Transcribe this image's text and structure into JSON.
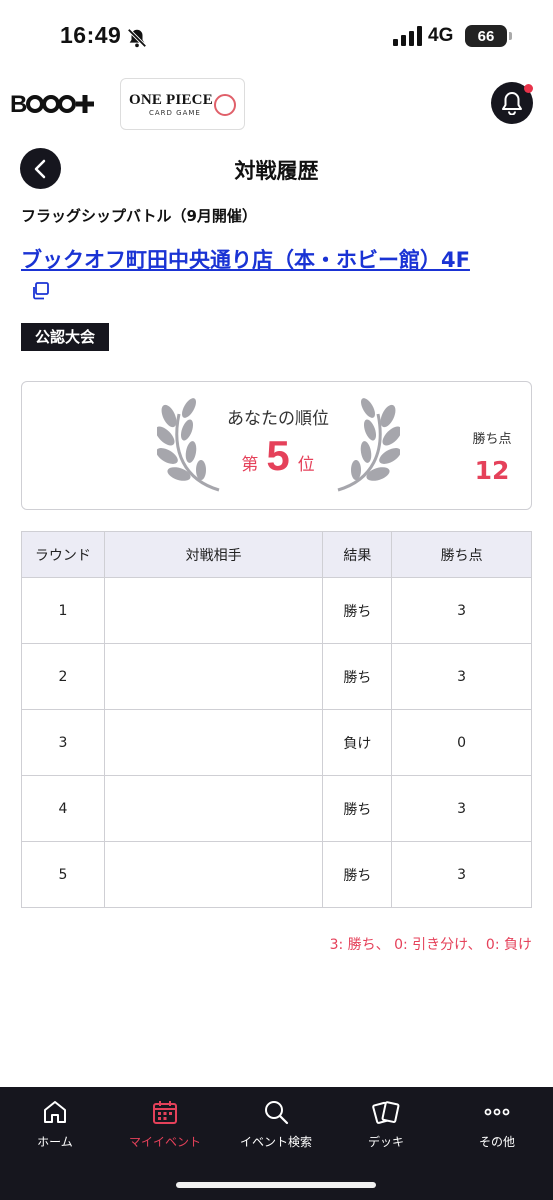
{
  "status_bar": {
    "time": "16:49",
    "network": "4G",
    "battery": "66"
  },
  "header": {
    "app_logo_text": "BOOG+",
    "game_logo_line1": "ONE PIECE",
    "game_logo_line2": "CARD GAME"
  },
  "page": {
    "title": "対戦履歴",
    "event_name": "フラッグシップバトル（9月開催）",
    "store_name": "ブックオフ町田中央通り店（本・ホビー館）4F",
    "badge": "公認大会"
  },
  "ranking": {
    "caption": "あなたの順位",
    "prefix": "第",
    "rank": "5",
    "suffix": "位",
    "points_label": "勝ち点",
    "points": "12"
  },
  "table": {
    "headers": [
      "ラウンド",
      "対戦相手",
      "結果",
      "勝ち点"
    ],
    "rows": [
      {
        "round": "1",
        "opponent": "",
        "result": "勝ち",
        "points": "3"
      },
      {
        "round": "2",
        "opponent": "",
        "result": "勝ち",
        "points": "3"
      },
      {
        "round": "3",
        "opponent": "",
        "result": "負け",
        "points": "0"
      },
      {
        "round": "4",
        "opponent": "",
        "result": "勝ち",
        "points": "3"
      },
      {
        "round": "5",
        "opponent": "",
        "result": "勝ち",
        "points": "3"
      }
    ]
  },
  "legend": "3: 勝ち、 0: 引き分け、 0: 負け",
  "nav": {
    "items": [
      {
        "label": "ホーム",
        "icon": "home-icon"
      },
      {
        "label": "マイイベント",
        "icon": "calendar-icon"
      },
      {
        "label": "イベント検索",
        "icon": "search-icon"
      },
      {
        "label": "デッキ",
        "icon": "cards-icon"
      },
      {
        "label": "その他",
        "icon": "more-icon"
      }
    ],
    "active_index": 1
  },
  "colors": {
    "accent": "#e5415a",
    "link": "#1a33d4",
    "dark": "#16161e"
  }
}
